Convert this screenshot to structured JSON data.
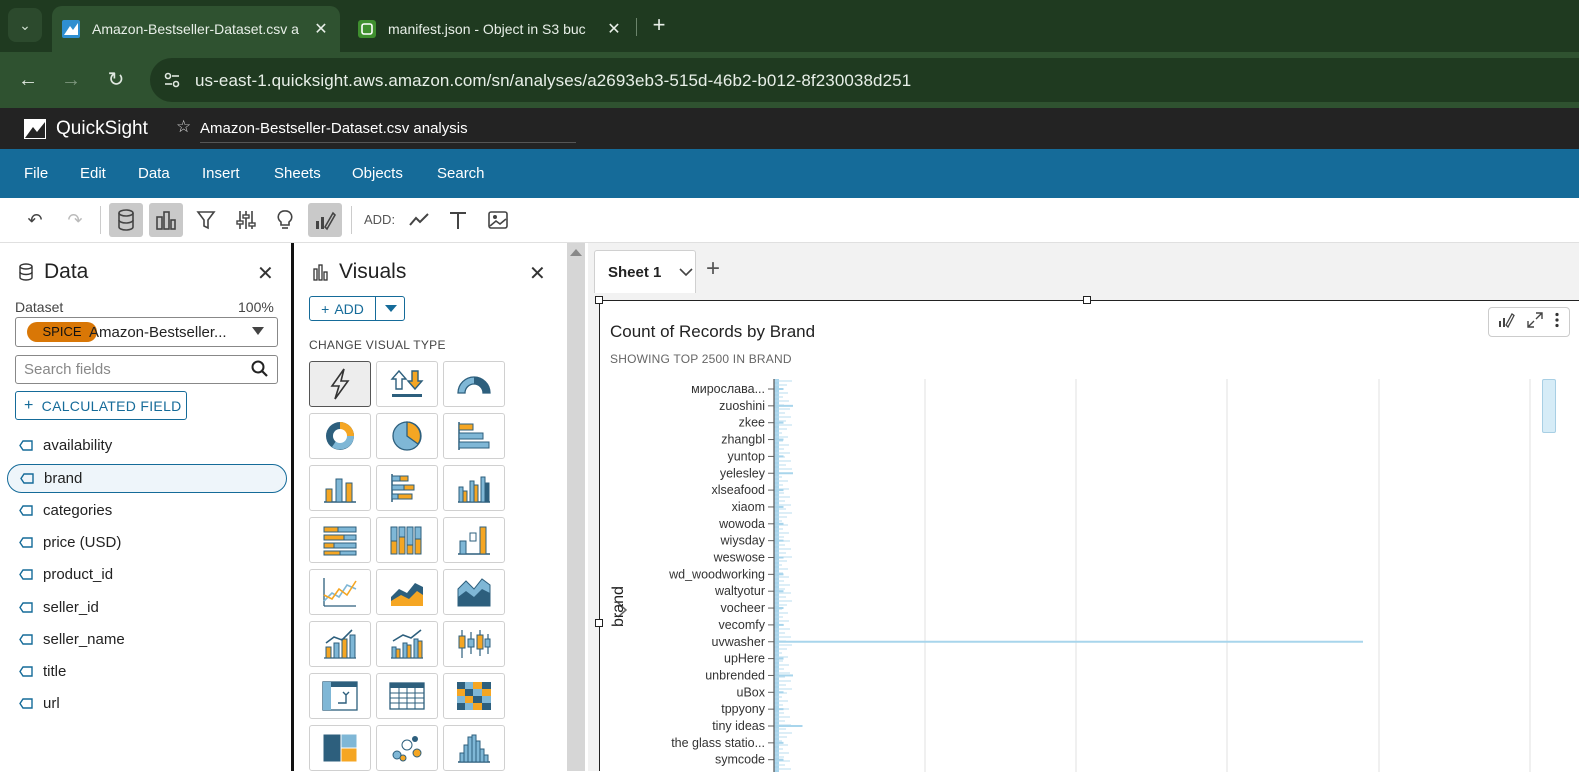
{
  "browser": {
    "tabs": [
      {
        "title": "Amazon-Bestseller-Dataset.csv a",
        "active": true,
        "icon": "quicksight-icon"
      },
      {
        "title": "manifest.json - Object in S3 buc",
        "active": false,
        "icon": "s3-icon"
      }
    ],
    "url": "us-east-1.quicksight.aws.amazon.com/sn/analyses/a2693eb3-515d-46b2-b012-8f230038d251"
  },
  "app": {
    "name": "QuickSight",
    "analysis_title": "Amazon-Bestseller-Dataset.csv analysis"
  },
  "menu": [
    "File",
    "Edit",
    "Data",
    "Insert",
    "Sheets",
    "Objects",
    "Search"
  ],
  "toolbar": {
    "add_label": "ADD:"
  },
  "data_panel": {
    "title": "Data",
    "dataset_label": "Dataset",
    "dataset_percent": "100%",
    "spice_badge": "SPICE",
    "dataset_name": "Amazon-Bestseller...",
    "search_placeholder": "Search fields",
    "calculated_field_label": "CALCULATED FIELD",
    "fields": [
      "availability",
      "brand",
      "categories",
      "price (USD)",
      "product_id",
      "seller_id",
      "seller_name",
      "title",
      "url"
    ],
    "selected_field": "brand"
  },
  "visuals_panel": {
    "title": "Visuals",
    "add_label": "ADD",
    "change_visual_type_label": "CHANGE VISUAL TYPE",
    "types": [
      "autograph",
      "kpi",
      "gauge",
      "donut",
      "pie",
      "horizontal-bar",
      "vertical-bar",
      "stacked-horizontal-bar",
      "clustered-bar",
      "stacked-100-bar",
      "stacked-column",
      "waterfall",
      "line",
      "area",
      "stacked-area",
      "combo-bar-line",
      "combo-clustered-line",
      "box-plot",
      "pivot-table",
      "table",
      "heat-map",
      "tree-map",
      "scatter",
      "histogram"
    ],
    "selected_type": "autograph"
  },
  "sheet": {
    "tab_label": "Sheet 1"
  },
  "colors": {
    "menubar": "#156b99",
    "accent_orange": "#f5a623",
    "accent_blue": "#7fb7d6",
    "bar": "#a8d5ec"
  },
  "visual": {
    "title": "Count of Records by Brand",
    "subtitle": "SHOWING TOP 2500 IN BRAND",
    "y_axis_label": "brand"
  },
  "chart_data": {
    "type": "bar",
    "orientation": "horizontal",
    "title": "Count of Records by Brand",
    "ylabel": "brand",
    "categories": [
      "миpослава...",
      "zuoshini",
      "zkee",
      "zhangbl",
      "yuntop",
      "yelesley",
      "xlseafood",
      "xiaom",
      "wowoda",
      "wiysday",
      "weswose",
      "wd_woodworking",
      "waltyotur",
      "vocheer",
      "vecomfy",
      "uvwasher",
      "upHere",
      "unbrended",
      "uBox",
      "tppyony",
      "tiny ideas",
      "the glass statio...",
      "symcode"
    ],
    "values": [
      1,
      2,
      1,
      1,
      1,
      2,
      1,
      1,
      1,
      1,
      1,
      1,
      1,
      1,
      1,
      62,
      1,
      2,
      1,
      1,
      3,
      1,
      1
    ],
    "grid": true
  }
}
